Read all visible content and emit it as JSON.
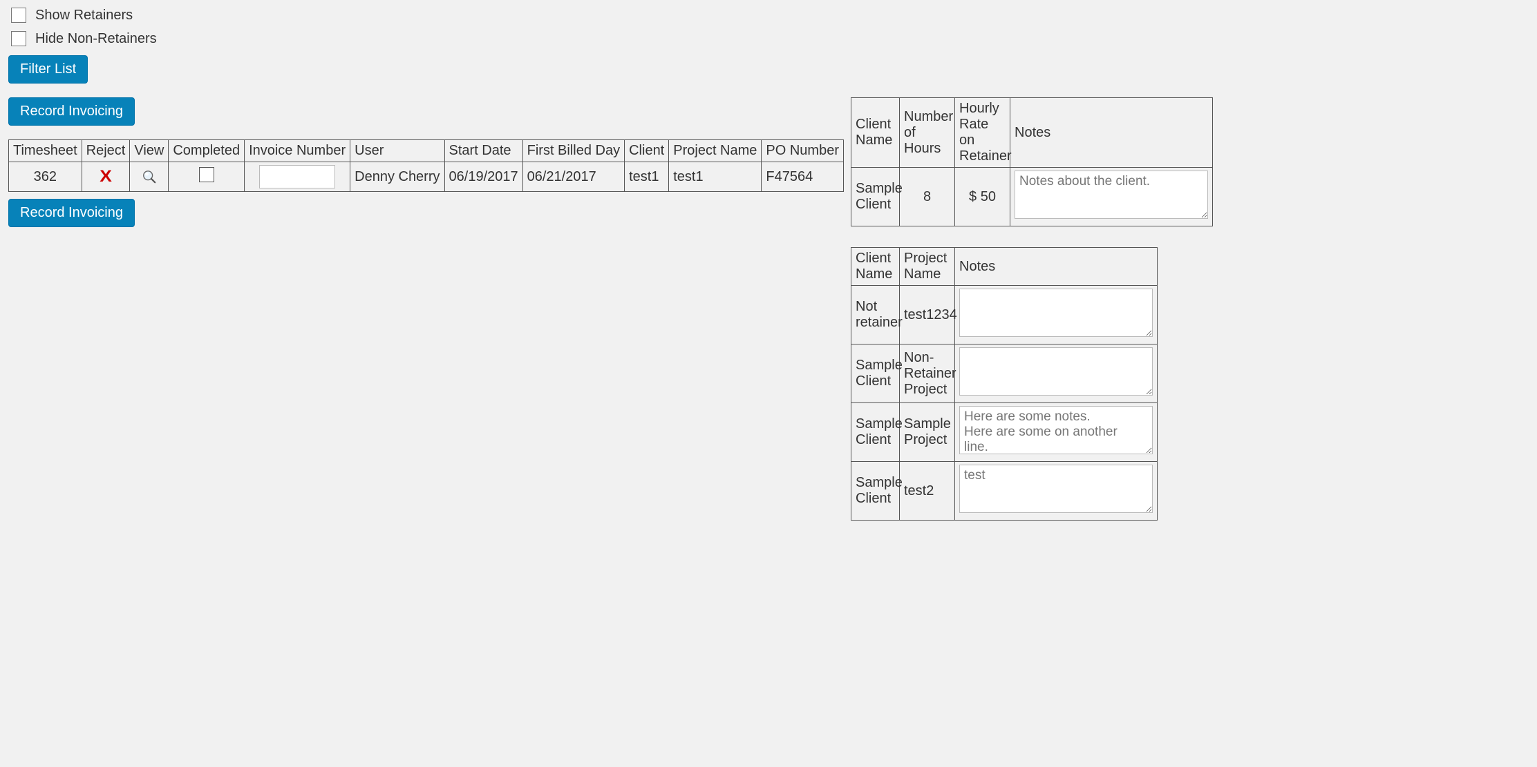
{
  "filters": {
    "show_retainers_label": "Show Retainers",
    "hide_non_retainers_label": "Hide Non-Retainers",
    "filter_button": "Filter List"
  },
  "buttons": {
    "record_invoicing": "Record Invoicing"
  },
  "timesheet_table": {
    "headers": {
      "timesheet": "Timesheet",
      "reject": "Reject",
      "view": "View",
      "completed": "Completed",
      "invoice_number": "Invoice Number",
      "user": "User",
      "start_date": "Start Date",
      "first_billed_day": "First Billed Day",
      "client": "Client",
      "project_name": "Project Name",
      "po_number": "PO Number"
    },
    "rows": [
      {
        "timesheet": "362",
        "invoice_number": "",
        "user": "Denny Cherry",
        "start_date": "06/19/2017",
        "first_billed_day": "06/21/2017",
        "client": "test1",
        "project_name": "test1",
        "po_number": "F47564"
      }
    ]
  },
  "retainer_table": {
    "headers": {
      "client_name": "Client Name",
      "number_of_hours": "Number of Hours",
      "hourly_rate": "Hourly Rate on Retainer",
      "notes": "Notes"
    },
    "rows": [
      {
        "client_name": "Sample Client",
        "number_of_hours": "8",
        "hourly_rate": "$ 50",
        "notes_placeholder": "Notes about the client.",
        "notes": ""
      }
    ]
  },
  "projects_table": {
    "headers": {
      "client_name": "Client Name",
      "project_name": "Project Name",
      "notes": "Notes"
    },
    "rows": [
      {
        "client_name": "Not retainer",
        "project_name": "test1234",
        "notes": ""
      },
      {
        "client_name": "Sample Client",
        "project_name": "Non-Retainer Project",
        "notes": ""
      },
      {
        "client_name": "Sample Client",
        "project_name": "Sample Project",
        "notes": "Here are some notes.\nHere are some on another line."
      },
      {
        "client_name": "Sample Client",
        "project_name": "test2",
        "notes": "test"
      }
    ]
  }
}
